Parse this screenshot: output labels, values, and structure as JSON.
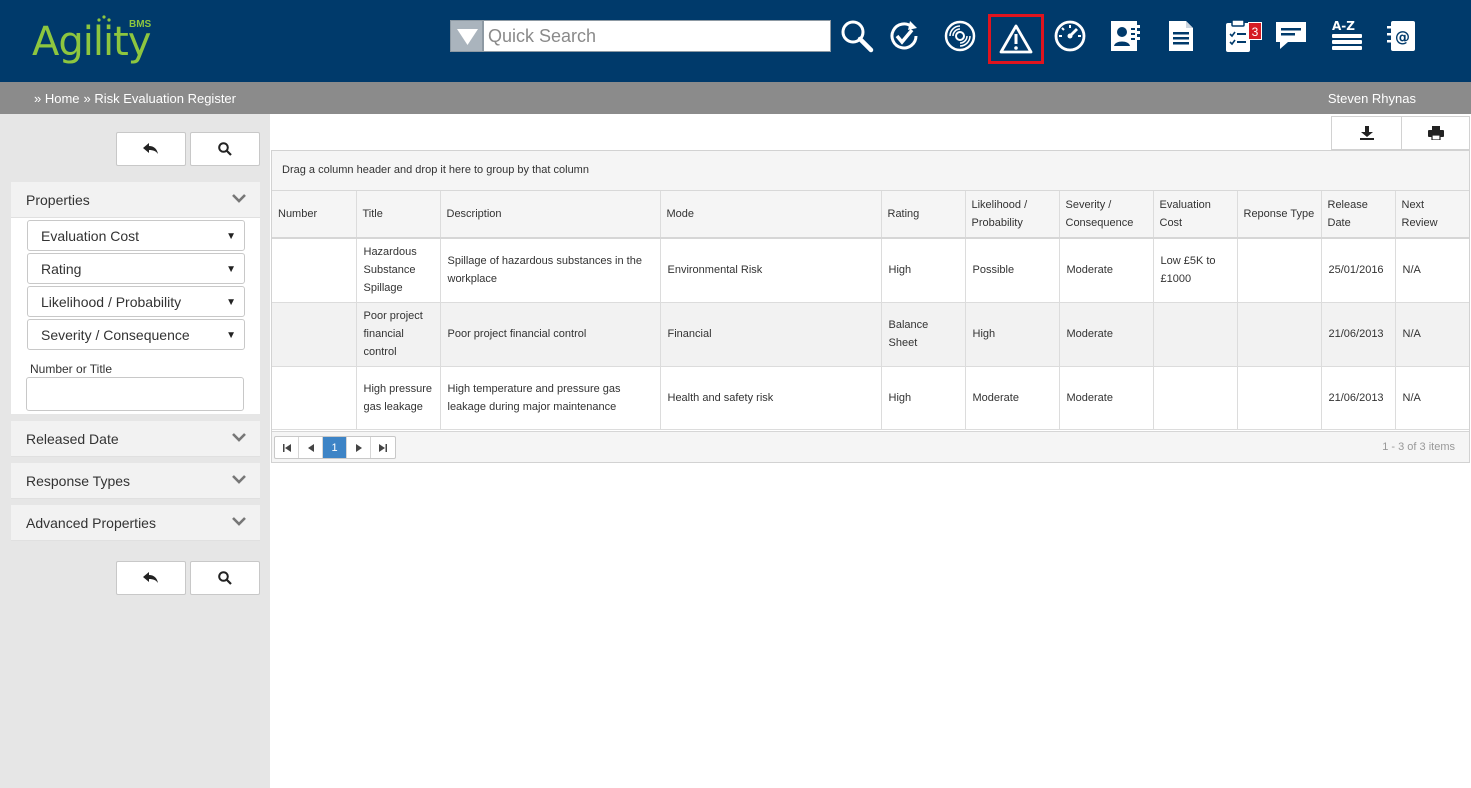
{
  "header": {
    "logo_text": "Agility",
    "logo_bms": "BMS",
    "search_placeholder": "Quick Search",
    "tasks_badge": "3",
    "icons": [
      "search-icon",
      "refresh-check-icon",
      "disc-icon",
      "warning-icon",
      "speedometer-icon",
      "contacts-icon",
      "document-icon",
      "clipboard-tasks-icon",
      "chat-icon",
      "a-z-icon",
      "address-book-icon"
    ]
  },
  "breadcrumb": {
    "home": "» Home",
    "page": "» Risk Evaluation Register",
    "user": "Steven Rhynas"
  },
  "sidebar": {
    "properties": {
      "title": "Properties",
      "dropdowns": [
        "Evaluation Cost",
        "Rating",
        "Likelihood / Probability",
        "Severity / Consequence"
      ],
      "number_title_label": "Number or Title"
    },
    "sections": [
      "Released Date",
      "Response Types",
      "Advanced Properties"
    ]
  },
  "grid": {
    "group_hint": "Drag a column header and drop it here to group by that column",
    "columns": [
      "Number",
      "Title",
      "Description",
      "Mode",
      "Rating",
      "Likelihood / Probability",
      "Severity / Consequence",
      "Evaluation Cost",
      "Reponse Type",
      "Release Date",
      "Next Review"
    ],
    "rows": [
      {
        "number": "",
        "title": "Hazardous Substance Spillage",
        "description": "Spillage of hazardous substances in the workplace",
        "mode": "Environmental Risk",
        "rating": "High",
        "likelihood": "Possible",
        "severity": "Moderate",
        "cost": "Low £5K to £1000",
        "response": "",
        "release": "25/01/2016",
        "review": "N/A"
      },
      {
        "number": "",
        "title": "Poor project financial control",
        "description": "Poor project financial control",
        "mode": "Financial",
        "rating": "Balance Sheet",
        "likelihood": "High",
        "severity": "Moderate",
        "cost": "",
        "response": "",
        "release": "21/06/2013",
        "review": "N/A"
      },
      {
        "number": "",
        "title": "High pressure gas leakage",
        "description": "High temperature and pressure gas leakage during major maintenance",
        "mode": "Health and safety risk",
        "rating": "High",
        "likelihood": "Moderate",
        "severity": "Moderate",
        "cost": "",
        "response": "",
        "release": "21/06/2013",
        "review": "N/A"
      }
    ],
    "pager": {
      "current": "1",
      "info": "1 - 3 of 3 items"
    }
  },
  "colors": {
    "header_bg": "#003a6b",
    "accent_green": "#8dc63f",
    "active_red": "#e0141e",
    "pager_blue": "#3d84c6"
  }
}
